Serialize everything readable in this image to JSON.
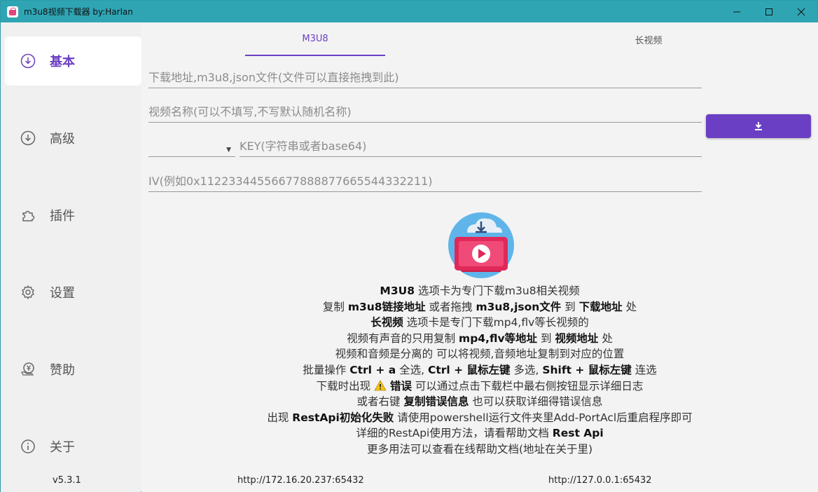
{
  "window": {
    "title": "m3u8视频下载器 by:Harlan",
    "controls": {
      "minimize": "—",
      "maximize": "☐",
      "close": "✕"
    }
  },
  "sidebar": {
    "items": [
      {
        "label": "基本",
        "icon": "download-circle-icon",
        "active": true
      },
      {
        "label": "高级",
        "icon": "download-circle-icon",
        "active": false
      },
      {
        "label": "插件",
        "icon": "puzzle-icon",
        "active": false
      },
      {
        "label": "设置",
        "icon": "gear-icon",
        "active": false
      },
      {
        "label": "赞助",
        "icon": "yen-hand-icon",
        "active": false
      },
      {
        "label": "关于",
        "icon": "info-icon",
        "active": false
      }
    ],
    "version": "v5.3.1"
  },
  "tabs": [
    {
      "label": "M3U8",
      "active": true
    },
    {
      "label": "长视频",
      "active": false
    }
  ],
  "form": {
    "url_placeholder": "下载地址,m3u8,json文件(文件可以直接拖拽到此)",
    "name_placeholder": "视频名称(可以不填写,不写默认随机名称)",
    "method_value": "",
    "key_placeholder": "KEY(字符串或者base64)",
    "iv_placeholder": "IV(例如0x11223344556677888877665544332211)"
  },
  "help": {
    "l1": [
      "M3U8",
      " 选项卡为专门下载m3u8相关视频"
    ],
    "l2": [
      "复制 ",
      "m3u8链接地址",
      " 或者拖拽 ",
      "m3u8,json文件",
      " 到 ",
      "下载地址",
      " 处"
    ],
    "l3": [
      "长视频",
      " 选项卡是专门下载mp4,flv等长视频的"
    ],
    "l4": [
      "视频有声音的只用复制 ",
      "mp4,flv等地址",
      " 到 ",
      "视频地址",
      " 处"
    ],
    "l5": [
      "视频和音频是分离的 可以将视频,音频地址复制到对应的位置"
    ],
    "l6": [
      "批量操作 ",
      "Ctrl + a",
      " 全选, ",
      "Ctrl + 鼠标左键",
      " 多选, ",
      "Shift + 鼠标左键",
      " 连选"
    ],
    "l7": [
      "下载时出现 ",
      "错误",
      " 可以通过点击下载栏中最右侧按钮显示详细日志"
    ],
    "l8": [
      "或者右键 ",
      "复制错误信息",
      " 也可以获取详细得错误信息"
    ],
    "l9": [
      "出现 ",
      "RestApi初始化失败",
      " 请使用powershell运行文件夹里Add-PortAcl后重启程序即可"
    ],
    "l10": [
      "详细的RestApi使用方法，请看帮助文档 ",
      "Rest Api"
    ],
    "l11": [
      "更多用法可以查看在线帮助文档(地址在关于里)"
    ]
  },
  "footer": {
    "left_address": "http://172.16.20.237:65432",
    "right_address": "http://127.0.0.1:65432"
  },
  "colors": {
    "accent": "#6b3fc4",
    "titlebar": "#2fa5b4",
    "warning": "#f5c518"
  }
}
